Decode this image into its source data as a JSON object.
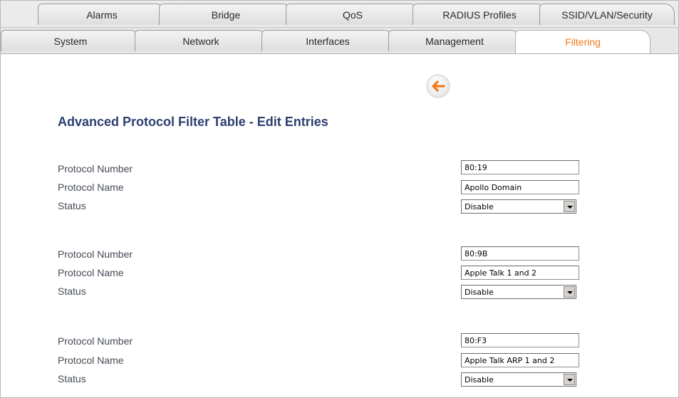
{
  "tabs_top": [
    "Alarms",
    "Bridge",
    "QoS",
    "RADIUS Profiles",
    "SSID/VLAN/Security"
  ],
  "tabs_bottom": [
    "System",
    "Network",
    "Interfaces",
    "Management",
    "Filtering"
  ],
  "active_tab": "Filtering",
  "accent_color": "#f07a1d",
  "title_color": "#2c3f70",
  "page_title": "Advanced Protocol Filter Table - Edit Entries",
  "back_button_icon": "back-arrow-icon",
  "labels": {
    "protocol_number": "Protocol Number",
    "protocol_name": "Protocol Name",
    "status": "Status"
  },
  "entries": [
    {
      "number": "80:19",
      "name": "Apollo Domain",
      "status": "Disable"
    },
    {
      "number": "80:9B",
      "name": "Apple Talk 1 and 2",
      "status": "Disable"
    },
    {
      "number": "80:F3",
      "name": "Apple Talk ARP 1 and 2",
      "status": "Disable"
    }
  ]
}
